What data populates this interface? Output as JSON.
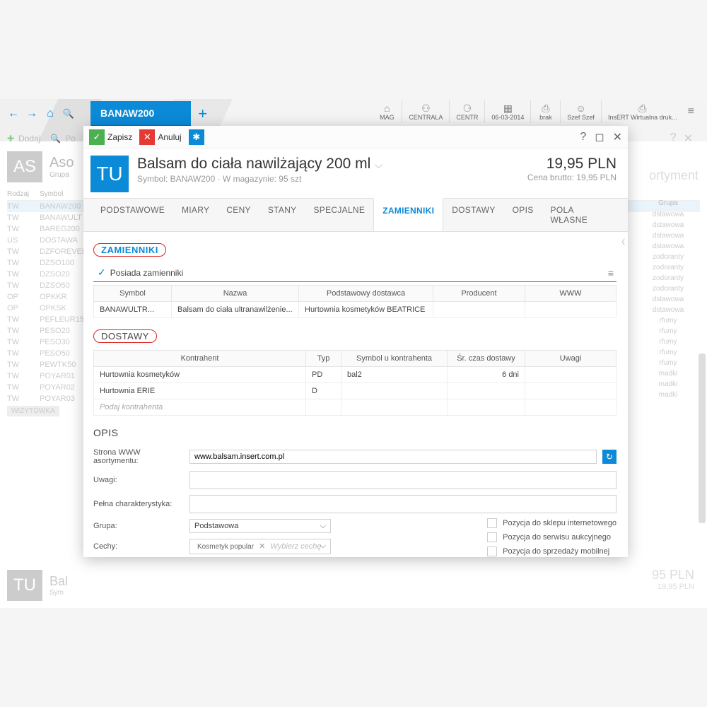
{
  "nav": {
    "breadcrumb": "BANAW200"
  },
  "status_cells": [
    {
      "icon": "⌂",
      "label": "MAG"
    },
    {
      "icon": "⚇",
      "label": "CENTRALA"
    },
    {
      "icon": "⚆",
      "label": "CENTR"
    },
    {
      "icon": "▦",
      "label": "06-03-2014"
    },
    {
      "icon": "⎙",
      "label": "brak"
    },
    {
      "icon": "☺",
      "label": "Szef Szef"
    },
    {
      "icon": "⎙",
      "label": "InsERT Wirtualna druk..."
    }
  ],
  "bg": {
    "toolbar_add": "Dodaj",
    "toolbar_po": "Po",
    "badge": "AS",
    "title": "Aso",
    "sub": "Grupa",
    "cols": {
      "rodzaj": "Rodzaj",
      "symbol": "Symbol",
      "grupa": "Grupa"
    },
    "rows": [
      {
        "r": "TW",
        "s": "BANAW200",
        "g": "dstawowa",
        "sel": true
      },
      {
        "r": "TW",
        "s": "BANAWULT",
        "g": "dstawowa"
      },
      {
        "r": "TW",
        "s": "BAREG200",
        "g": "dstawowa"
      },
      {
        "r": "US",
        "s": "DOSTAWA",
        "g": "dstawowa"
      },
      {
        "r": "TW",
        "s": "DZFOREVER",
        "g": "zodoranty"
      },
      {
        "r": "TW",
        "s": "DZSO100",
        "g": "zodoranty"
      },
      {
        "r": "TW",
        "s": "DZSO20",
        "g": "zodoranty"
      },
      {
        "r": "TW",
        "s": "DZSO50",
        "g": "zodoranty"
      },
      {
        "r": "OP",
        "s": "OPKKR",
        "g": "dstawowa"
      },
      {
        "r": "OP",
        "s": "OPKSK",
        "g": "dstawowa"
      },
      {
        "r": "TW",
        "s": "PEFLEUR15",
        "g": "rfumy"
      },
      {
        "r": "TW",
        "s": "PESO20",
        "g": "rfumy"
      },
      {
        "r": "TW",
        "s": "PESO30",
        "g": "rfumy"
      },
      {
        "r": "TW",
        "s": "PESO50",
        "g": "rfumy"
      },
      {
        "r": "TW",
        "s": "PEWTK50",
        "g": "rfumy"
      },
      {
        "r": "TW",
        "s": "POYAR01",
        "g": "madki"
      },
      {
        "r": "TW",
        "s": "POYAR02",
        "g": "madki"
      },
      {
        "r": "TW",
        "s": "POYAR03",
        "g": "madki"
      }
    ],
    "wizytowka": "WIZYTÓWKA",
    "asort": "ortyment",
    "bottom_badge": "TU",
    "bottom_title": "Bal",
    "bottom_sub": "Sym",
    "bottom_price": "95 PLN",
    "bottom_price2": "19,95 PLN"
  },
  "dlg": {
    "save": "Zapisz",
    "cancel": "Anuluj",
    "badge": "TU",
    "title": "Balsam do ciała nawilżający 200 ml",
    "sub": "Symbol: BANAW200  ·  W magazynie: 95 szt",
    "price": "19,95 PLN",
    "price_sub": "Cena brutto: 19,95 PLN",
    "tabs": [
      "PODSTAWOWE",
      "MIARY",
      "CENY",
      "STANY",
      "SPECJALNE",
      "ZAMIENNIKI",
      "DOSTAWY",
      "OPIS",
      "POLA WŁASNE"
    ],
    "active_tab": "ZAMIENNIKI",
    "sec_zamienniki": "ZAMIENNIKI",
    "has_replacements": "Posiada zamienniki",
    "zam_cols": {
      "symbol": "Symbol",
      "nazwa": "Nazwa",
      "dostawca": "Podstawowy dostawca",
      "producent": "Producent",
      "www": "WWW"
    },
    "zam_rows": [
      {
        "symbol": "BANAWULTR...",
        "nazwa": "Balsam do ciała ultranawilżenie...",
        "dostawca": "Hurtownia kosmetyków BEATRICE",
        "producent": "",
        "www": ""
      }
    ],
    "sec_dostawy": "DOSTAWY",
    "dos_cols": {
      "kontrahent": "Kontrahent",
      "typ": "Typ",
      "symbolk": "Symbol u kontrahenta",
      "czas": "Śr. czas dostawy",
      "uwagi": "Uwagi"
    },
    "dos_rows": [
      {
        "kontrahent": "Hurtownia kosmetyków",
        "typ": "PD",
        "symbolk": "bal2",
        "czas": "6 dni",
        "uwagi": ""
      },
      {
        "kontrahent": "Hurtownia ERIE",
        "typ": "D",
        "symbolk": "",
        "czas": "",
        "uwagi": ""
      }
    ],
    "dos_placeholder": "Podaj kontrahenta",
    "sec_opis": "OPIS",
    "opis": {
      "www_label": "Strona WWW asortymentu:",
      "www_val": "www.balsam.insert.com.pl",
      "uwagi_label": "Uwagi:",
      "pelna_label": "Pełna charakterystyka:",
      "grupa_label": "Grupa:",
      "grupa_val": "Podstawowa",
      "cechy_label": "Cechy:",
      "cechy_tag": "Kosmetyk popular",
      "cechy_ph": "Wybierz cechę",
      "cb1": "Pozycja do sklepu internetowego",
      "cb2": "Pozycja do serwisu aukcyjnego",
      "cb3": "Pozycja do sprzedaży mobilnej"
    }
  }
}
